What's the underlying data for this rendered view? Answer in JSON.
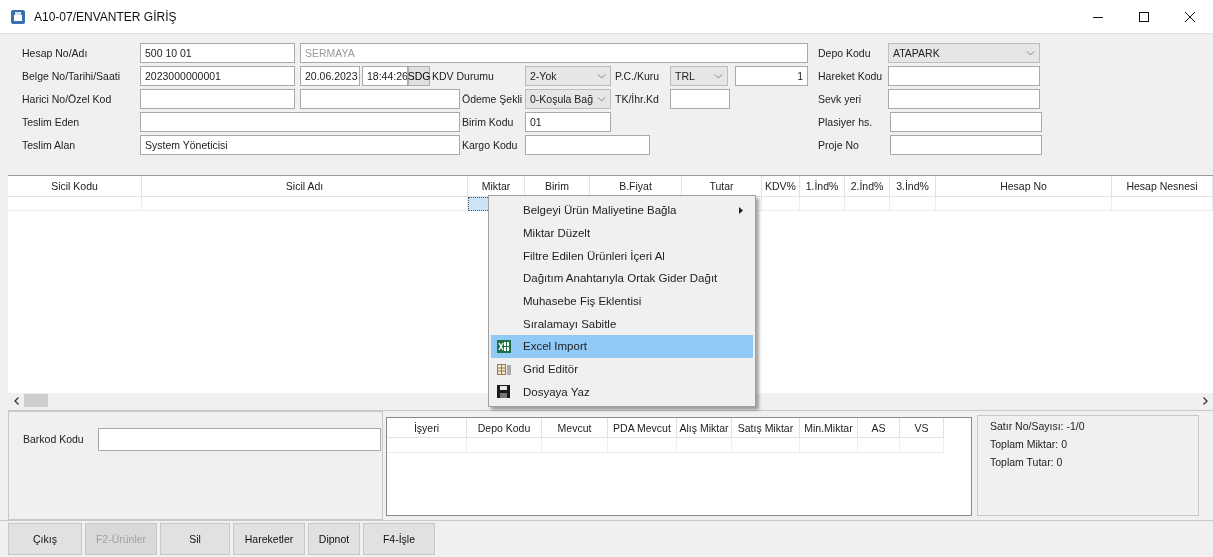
{
  "window": {
    "title": "A10-07/ENVANTER GİRİŞ"
  },
  "form": {
    "fields": [
      {
        "label": "Hesap No/Adı",
        "inputs": [
          {
            "kind": "field",
            "value": "500 10 01"
          },
          {
            "kind": "readonly",
            "value": "SERMAYA"
          }
        ]
      },
      {
        "label": "Depo Kodu",
        "inputs": [
          {
            "kind": "combo",
            "value": "ATAPARK"
          }
        ]
      },
      {
        "label": "Belge No/Tarihi/Saati",
        "inputs": [
          {
            "kind": "field",
            "value": "2023000000001"
          },
          {
            "kind": "field",
            "value": "20.06.2023"
          },
          {
            "kind": "field",
            "value": "18:44:26"
          },
          {
            "kind": "button",
            "value": "SDG"
          }
        ]
      },
      {
        "label": "KDV Durumu",
        "inputs": [
          {
            "kind": "combo",
            "value": "2-Yok"
          }
        ]
      },
      {
        "label": "P.C./Kuru",
        "inputs": [
          {
            "kind": "combo",
            "value": "TRL"
          },
          {
            "kind": "number",
            "value": "1"
          }
        ]
      },
      {
        "label": "Hareket Kodu",
        "inputs": [
          {
            "kind": "field"
          }
        ]
      },
      {
        "label": "Harici No/Özel Kod",
        "inputs": [
          {
            "kind": "field"
          },
          {
            "kind": "field"
          }
        ]
      },
      {
        "label": "Ödeme Şekli",
        "inputs": [
          {
            "kind": "combo",
            "value": "0-Koşula Bağ"
          }
        ]
      },
      {
        "label": "TK/İhr.Kd",
        "inputs": [
          {
            "kind": "field"
          }
        ]
      },
      {
        "label": "Sevk yeri",
        "inputs": [
          {
            "kind": "field"
          }
        ]
      },
      {
        "label": "Teslim Eden",
        "inputs": [
          {
            "kind": "field"
          }
        ]
      },
      {
        "label": "Birim Kodu",
        "inputs": [
          {
            "kind": "field",
            "value": "01"
          }
        ]
      },
      {
        "label": "Plasiyer hs.",
        "inputs": [
          {
            "kind": "field"
          }
        ]
      },
      {
        "label": "Teslim Alan",
        "inputs": [
          {
            "kind": "field",
            "value": "System Yöneticisi"
          }
        ]
      },
      {
        "label": "Kargo Kodu",
        "inputs": [
          {
            "kind": "field"
          }
        ]
      },
      {
        "label": "Proje No",
        "inputs": [
          {
            "kind": "field"
          }
        ]
      }
    ]
  },
  "table": {
    "columns": [
      {
        "label": "Sicil Kodu",
        "selected": false
      },
      {
        "label": "Sicil Adı",
        "selected": false
      },
      {
        "label": "Miktar",
        "selected": true
      },
      {
        "label": "Birim",
        "selected": false
      },
      {
        "label": "B.Fiyat",
        "selected": false
      },
      {
        "label": "Tutar",
        "selected": false
      },
      {
        "label": "KDV%",
        "selected": false
      },
      {
        "label": "1.İnd%",
        "selected": false
      },
      {
        "label": "2.İnd%",
        "selected": false
      },
      {
        "label": "3.İnd%",
        "selected": false
      },
      {
        "label": "Hesap No",
        "selected": false
      },
      {
        "label": "Hesap Nesnesi",
        "selected": false
      }
    ]
  },
  "context_menu": {
    "items": [
      {
        "label": "Belgeyi Ürün Maliyetine Bağla",
        "kind": "plain",
        "submenu": true,
        "selected": false
      },
      {
        "label": "Miktar Düzelt",
        "kind": "plain",
        "submenu": false,
        "selected": false
      },
      {
        "label": "Filtre Edilen Ürünleri İçeri Al",
        "kind": "plain",
        "submenu": false,
        "selected": false
      },
      {
        "label": "Dağıtım Anahtarıyla Ortak Gider Dağıt",
        "kind": "plain",
        "submenu": false,
        "selected": false
      },
      {
        "label": "Muhasebe Fiş Eklentisi",
        "kind": "plain",
        "submenu": false,
        "selected": false
      },
      {
        "label": "Sıralamayı Sabitle",
        "kind": "plain",
        "submenu": false,
        "selected": false
      },
      {
        "label": "Excel Import",
        "kind": "spreadsheet",
        "submenu": false,
        "selected": true
      },
      {
        "label": "Grid Editör",
        "kind": "grid",
        "submenu": false,
        "selected": false
      },
      {
        "label": "Dosyaya Yaz",
        "kind": "floppy",
        "submenu": false,
        "selected": false
      }
    ]
  },
  "barcode": {
    "label": "Barkod Kodu"
  },
  "stock_table": {
    "columns": [
      "İşyeri",
      "Depo Kodu",
      "Mevcut",
      "PDA Mevcut",
      "Alış Miktar",
      "Satış Miktar",
      "Min.Miktar",
      "AS",
      "VS"
    ]
  },
  "summary": [
    "Satır No/Sayısı: -1/0",
    "Toplam Miktar: 0",
    "Toplam Tutar: 0"
  ],
  "buttons": [
    {
      "label": "Çıkış",
      "disabled": false
    },
    {
      "label": "F2-Ürünler",
      "disabled": true
    },
    {
      "label": "Sil",
      "disabled": false
    },
    {
      "label": "Hareketler",
      "disabled": false
    },
    {
      "label": "Dipnot",
      "disabled": false
    },
    {
      "label": "F4-İşle",
      "disabled": false
    }
  ]
}
